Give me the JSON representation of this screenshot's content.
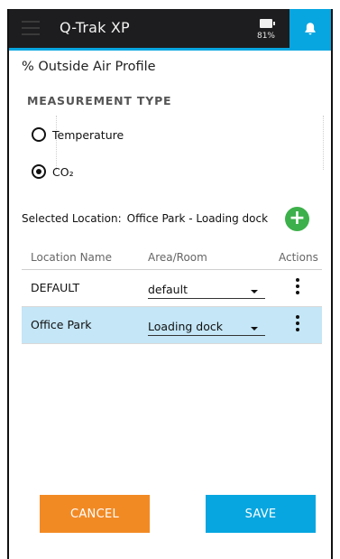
{
  "app": {
    "title": "Q-Trak XP",
    "battery_percent": "81%",
    "icons": {
      "menu": "menu-icon",
      "battery": "battery-icon",
      "notifications": "bell-icon"
    },
    "colors": {
      "topbar": "#1d1d1f",
      "accent": "#07a6e0",
      "add": "#3cb04a",
      "cancel": "#f28a24",
      "selected_row": "#c4e6f6"
    }
  },
  "page": {
    "title": "% Outside Air Profile"
  },
  "measurement": {
    "heading": "MEASUREMENT TYPE",
    "options": [
      {
        "label": "Temperature",
        "selected": false
      },
      {
        "label": "CO₂",
        "selected": true
      }
    ]
  },
  "selected_location": {
    "label": "Selected Location:",
    "value": "Office Park - Loading dock"
  },
  "table": {
    "headers": {
      "name": "Location Name",
      "area": "Area/Room",
      "actions": "Actions"
    },
    "rows": [
      {
        "name": "DEFAULT",
        "area": "default",
        "selected": false
      },
      {
        "name": "Office Park",
        "area": "Loading dock",
        "selected": true
      }
    ]
  },
  "buttons": {
    "cancel": "CANCEL",
    "save": "SAVE"
  }
}
